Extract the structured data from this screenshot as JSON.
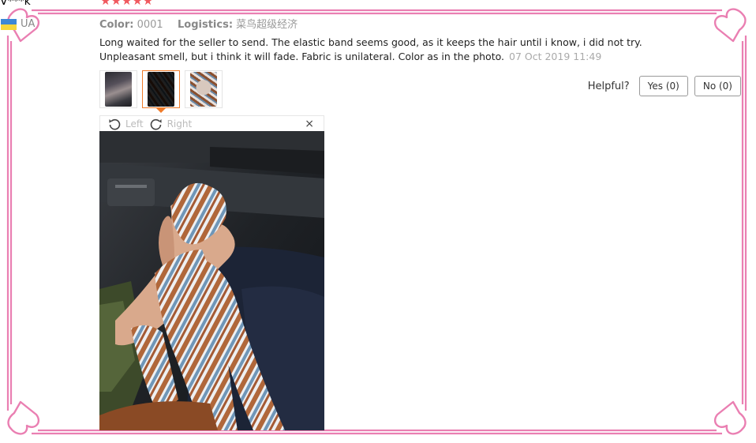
{
  "review": {
    "reviewer": "V***k",
    "stars": "★★★★★",
    "country_code": "UA",
    "color_label": "Color:",
    "color_value": "0001",
    "logistics_label": "Logistics:",
    "logistics_value": "菜鸟超级经济",
    "text_line1": "Long waited for the seller to send. The elastic band seems good, as it keeps the hair until i know, i did not try.",
    "text_line2": "Unpleasant smell, but i think it will fade. Fabric is unilateral. Color as in the photo.",
    "date": "07 Oct 2019 11:49"
  },
  "helpful": {
    "label": "Helpful?",
    "yes": "Yes (0)",
    "no": "No (0)"
  },
  "viewer": {
    "rotate_left": "Left",
    "rotate_right": "Right",
    "close": "×",
    "selected_thumb_index": 1
  },
  "colors": {
    "frame_pink": "#ea7fb2",
    "stars": "#f0595e",
    "thumb_selected": "#f07c2a"
  },
  "icons": [
    "rotate-left-icon",
    "rotate-right-icon",
    "close-icon",
    "ua-flag-icon",
    "heart-corner-ornament"
  ]
}
